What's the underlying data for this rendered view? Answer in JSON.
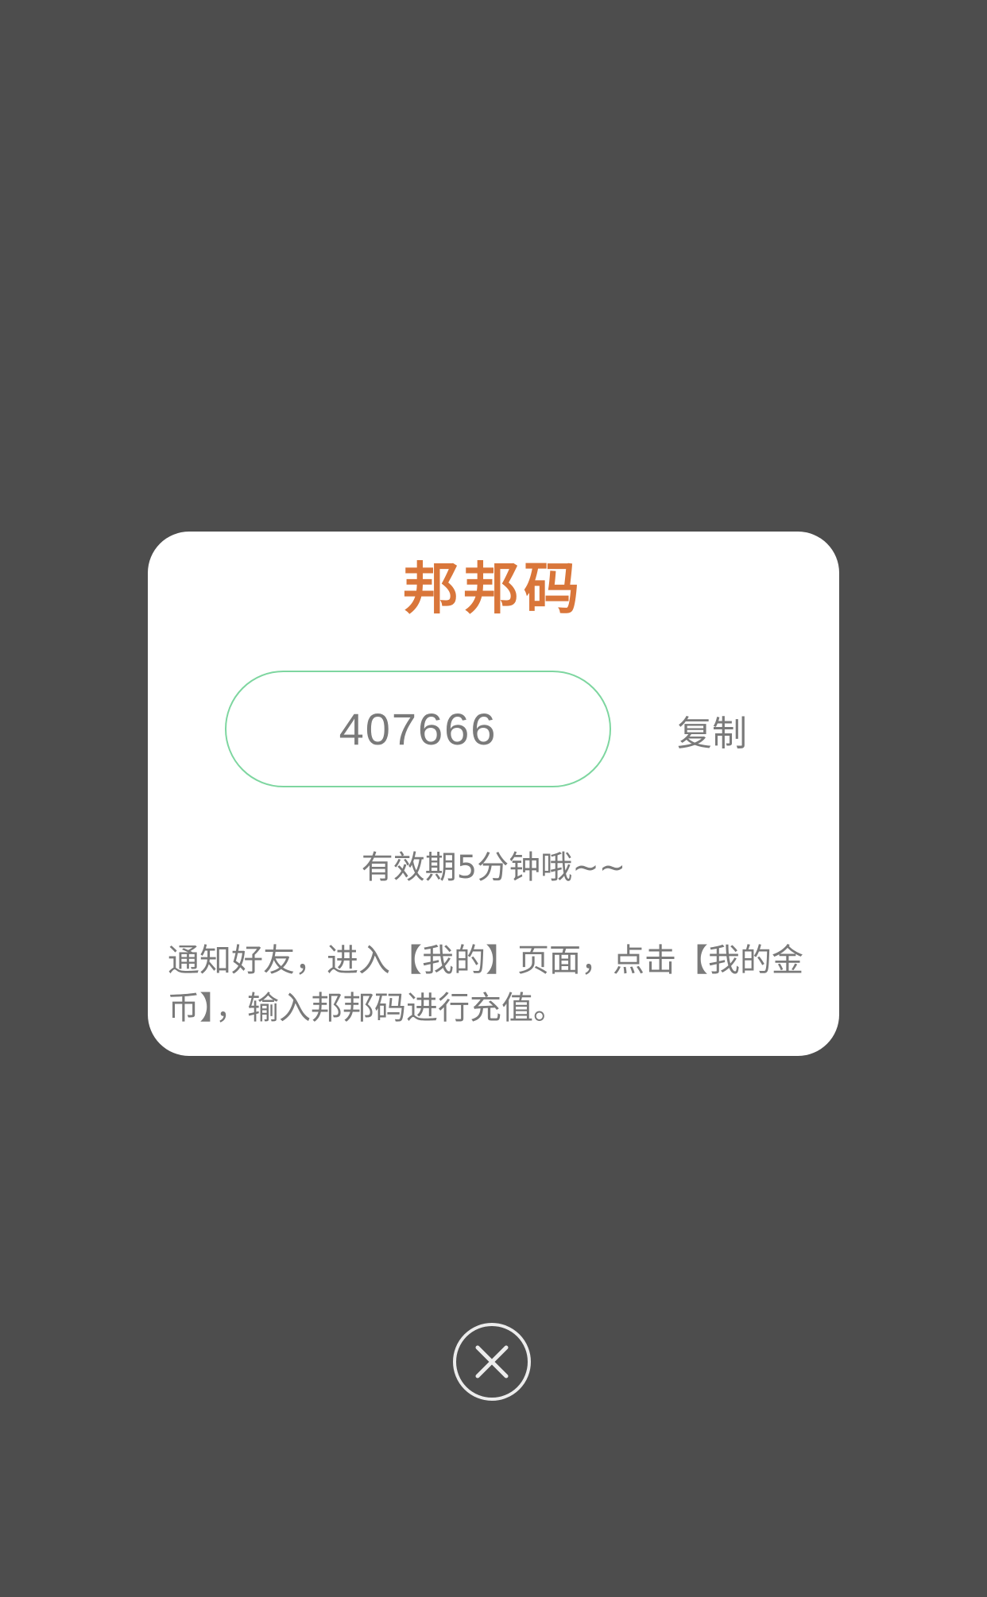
{
  "dialog": {
    "title": "邦邦码",
    "code": "407666",
    "copy_label": "复制",
    "validity_note": "有效期5分钟哦~~",
    "instructions": "通知好友，进入【我的】页面，点击【我的金币】，输入邦邦码进行充值。"
  },
  "close_button": {
    "icon": "close-icon"
  },
  "colors": {
    "overlay": "#4d4d4d",
    "title": "#d9763a",
    "code_border": "#7ed6a0",
    "text": "#7a7a7a"
  }
}
